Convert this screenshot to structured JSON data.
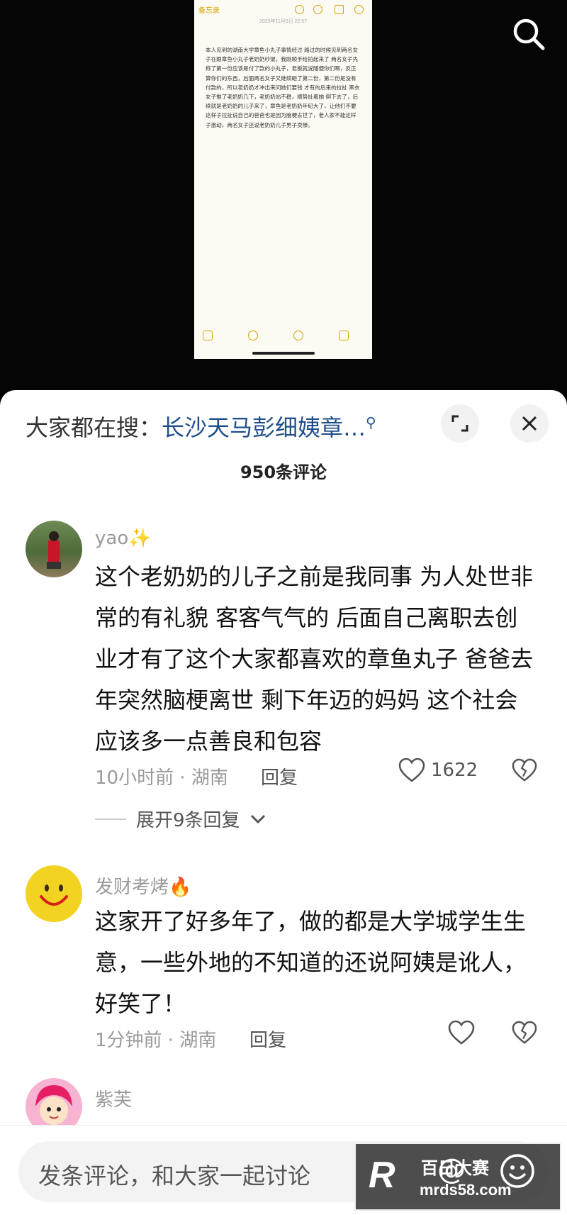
{
  "video": {
    "note_back": "备忘录",
    "note_date": "2025年11月5日 22:57",
    "note_text": "本人见到的湖南大学章鱼小丸子事情经过\n路过的时候见到两名女子在跟章鱼小丸子老奶奶吵架，我刚顺手给拍起来了 两名女子先称了第一份应该是付了款的小丸子，老板就说随便你们啊，反正算你们的东西，后面两名女子又继续砸了第二份，第二份是没有付款的，所以老奶奶才冲出来问她们要钱 才有的后来的拉扯 黑衣女子推了老奶奶几下，老奶奶站不稳，顺势扯着她 倒下去了，后续就是老奶奶的儿子来了，章鱼是老奶奶年纪大了，让他们不要这样子拉扯说自己的爸爸也是因为脑梗去世了，老人家不能这样子激动，两名女子还说老奶奶儿子男子卖惨。"
  },
  "header": {
    "search_prefix": "大家都在搜：",
    "search_keyword": "长沙天马彭细姨章…",
    "comment_count": "950条评论"
  },
  "comments": [
    {
      "user": "yao✨",
      "text": "这个老奶奶的儿子之前是我同事 为人处世非常的有礼貌 客客气气的 后面自己离职去创业才有了这个大家都喜欢的章鱼丸子 爸爸去年突然脑梗离世 剩下年迈的妈妈 这个社会应该多一点善良和包容",
      "meta": "10小时前 · 湖南",
      "reply": "回复",
      "likes": "1622",
      "expand": "展开9条回复"
    },
    {
      "user": "发财考烤🔥",
      "text": "这家开了好多年了，做的都是大学城学生生意，一些外地的不知道的还说阿姨是讹人，好笑了！",
      "meta": "1分钟前 · 湖南",
      "reply": "回复",
      "likes": ""
    },
    {
      "user": "紫芙"
    }
  ],
  "footer": {
    "input_placeholder": "发条评论，和大家一起讨论",
    "watermark_logo": "R",
    "watermark_name": "百日大赛",
    "watermark_url": "mrds58.com"
  },
  "colors": {
    "keyword": "#1f4e8c",
    "note_accent": "#d9a400"
  }
}
